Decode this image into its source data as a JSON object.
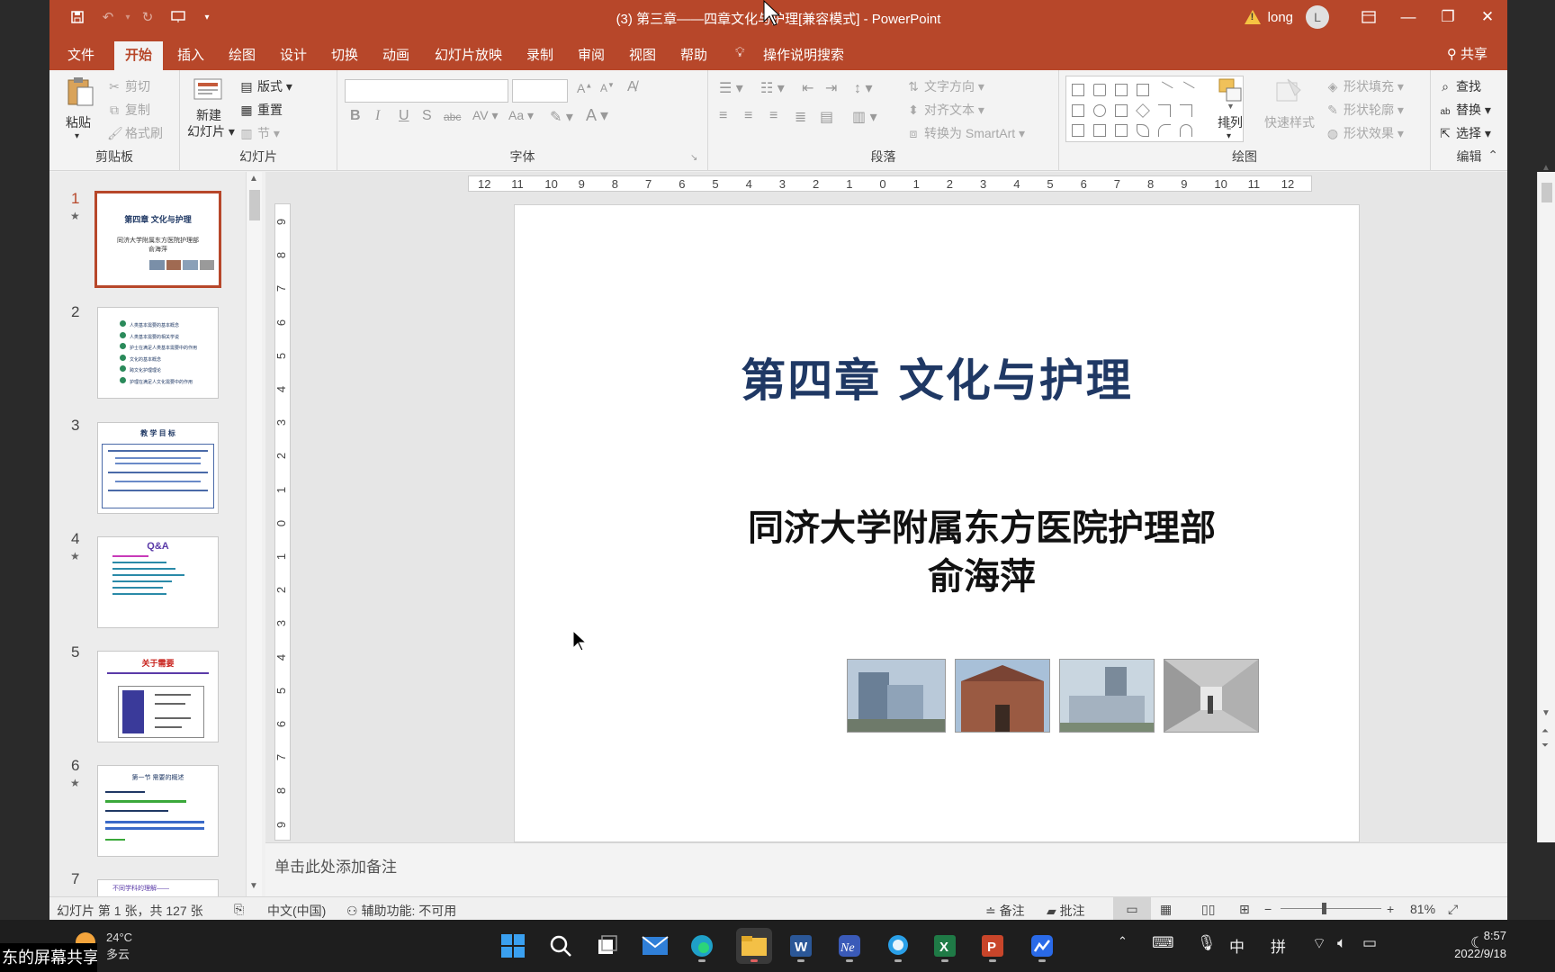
{
  "titlebar": {
    "title": "(3) 第三章——四章文化与护理[兼容模式] - PowerPoint",
    "user": "long",
    "avatar_initial": "L",
    "buttons": {
      "minimize": "—",
      "restore": "❐",
      "close": "✕"
    }
  },
  "tabs": [
    "文件",
    "开始",
    "插入",
    "绘图",
    "设计",
    "切换",
    "动画",
    "幻灯片放映",
    "录制",
    "审阅",
    "视图",
    "帮助"
  ],
  "active_tab": "开始",
  "tell_me": "操作说明搜索",
  "share_label": "共享",
  "ribbon": {
    "clipboard": {
      "label": "剪贴板",
      "paste": "粘贴",
      "cut": "剪切",
      "copy": "复制",
      "format_painter": "格式刷"
    },
    "slides": {
      "label": "幻灯片",
      "new_slide_line1": "新建",
      "new_slide_line2": "幻灯片",
      "layout": "版式",
      "reset": "重置",
      "section": "节"
    },
    "font": {
      "label": "字体"
    },
    "paragraph": {
      "label": "段落",
      "text_direction": "文字方向",
      "align_text": "对齐文本",
      "smartart": "转换为 SmartArt"
    },
    "drawing": {
      "label": "绘图",
      "arrange": "排列",
      "quick_styles": "快速样式",
      "shape_fill": "形状填充",
      "shape_outline": "形状轮廓",
      "shape_effects": "形状效果"
    },
    "editing": {
      "label": "编辑",
      "find": "查找",
      "replace": "替换",
      "select": "选择"
    }
  },
  "thumbnails": [
    {
      "num": "1",
      "star": true,
      "title": "第四章  文化与护理",
      "line1": "同济大学附属东方医院护理部",
      "line2": "俞海萍"
    },
    {
      "num": "2",
      "star": false,
      "items": [
        "人类基本需要的基本概念",
        "人类基本需要的相关学说",
        "护士在满足人类基本需要中的作用",
        "文化的基本概念",
        "跨文化护理理论",
        "护理在满足人文化需要中的作用"
      ]
    },
    {
      "num": "3",
      "star": false,
      "title": "教 学 目 标"
    },
    {
      "num": "4",
      "star": true,
      "title": "Q&A"
    },
    {
      "num": "5",
      "star": false,
      "title": "关于需要"
    },
    {
      "num": "6",
      "star": true,
      "title": "第一节  需要的概述"
    },
    {
      "num": "7",
      "star": false,
      "title": "不同学科的理解——"
    }
  ],
  "ruler_h": [
    "12",
    "11",
    "10",
    "9",
    "8",
    "7",
    "6",
    "5",
    "4",
    "3",
    "2",
    "1",
    "0",
    "1",
    "2",
    "3",
    "4",
    "5",
    "6",
    "7",
    "8",
    "9",
    "10",
    "11",
    "12"
  ],
  "ruler_v": [
    "9",
    "8",
    "7",
    "6",
    "5",
    "4",
    "3",
    "2",
    "1",
    "0",
    "1",
    "2",
    "3",
    "4",
    "5",
    "6",
    "7",
    "8",
    "9"
  ],
  "slide": {
    "title": "第四章  文化与护理",
    "subtitle1": "同济大学附属东方医院护理部",
    "subtitle2": "俞海萍"
  },
  "notes_placeholder": "单击此处添加备注",
  "status": {
    "slide_info": "幻灯片 第 1 张，共 127 张",
    "language": "中文(中国)",
    "accessibility": "辅助功能: 不可用",
    "notes": "备注",
    "comments": "批注",
    "zoom": "81%"
  },
  "taskbar": {
    "temp": "24°C",
    "weather": "多云",
    "ime1": "中",
    "ime2": "拼",
    "time": "8:57",
    "date": "2022/9/18",
    "banner": "东的屏幕共享"
  },
  "colors": {
    "accent": "#b7472a",
    "slide_title": "#1f3864"
  }
}
